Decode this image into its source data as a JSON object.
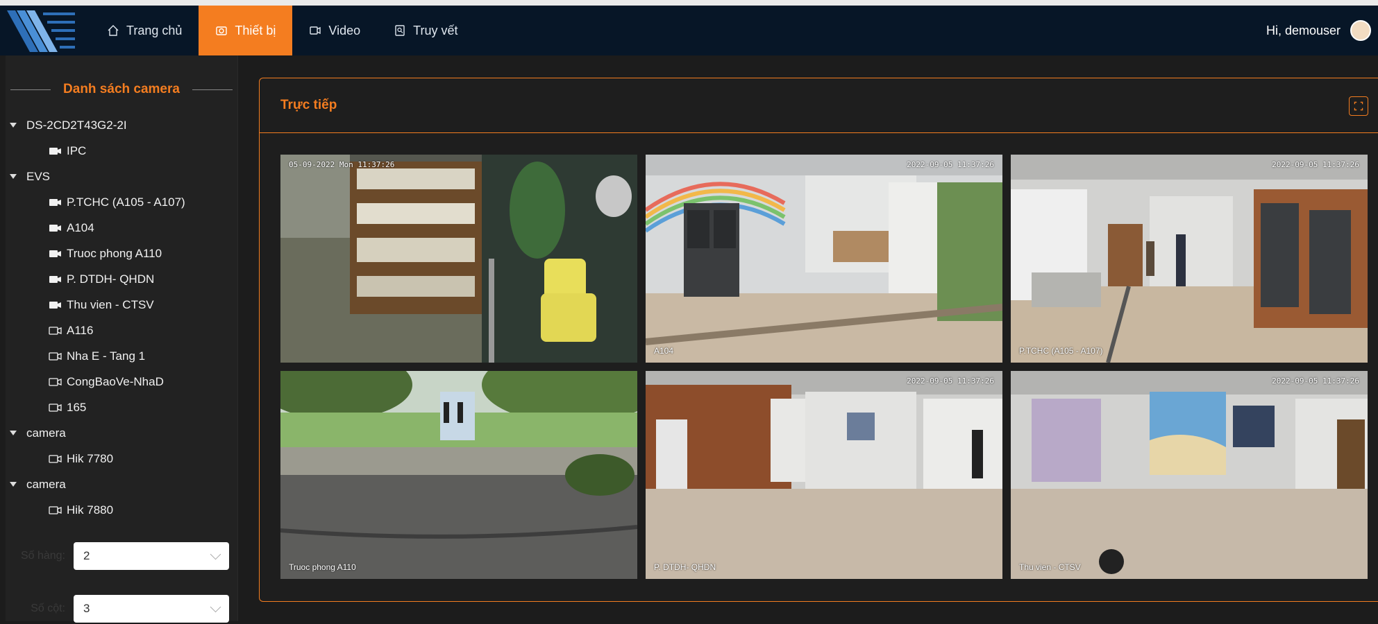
{
  "user": {
    "greeting": "Hi, demouser"
  },
  "nav": [
    {
      "label": "Trang chủ",
      "icon": "home-icon"
    },
    {
      "label": "Thiết bị",
      "icon": "camera-icon",
      "active": true
    },
    {
      "label": "Video",
      "icon": "video-icon"
    },
    {
      "label": "Truy vết",
      "icon": "trace-icon"
    }
  ],
  "sidebar": {
    "title": "Danh sách camera",
    "tree": [
      {
        "type": "group",
        "label": "DS-2CD2T43G2-2I"
      },
      {
        "type": "camera",
        "label": "IPC",
        "online": true
      },
      {
        "type": "group",
        "label": "EVS"
      },
      {
        "type": "camera",
        "label": "P.TCHC (A105 - A107)",
        "online": true
      },
      {
        "type": "camera",
        "label": "A104",
        "online": true
      },
      {
        "type": "camera",
        "label": "Truoc phong A110",
        "online": true
      },
      {
        "type": "camera",
        "label": "P. DTDH- QHDN",
        "online": true
      },
      {
        "type": "camera",
        "label": "Thu vien - CTSV",
        "online": true
      },
      {
        "type": "camera",
        "label": "A116",
        "online": false
      },
      {
        "type": "camera",
        "label": "Nha E - Tang 1",
        "online": false
      },
      {
        "type": "camera",
        "label": "CongBaoVe-NhaD",
        "online": false
      },
      {
        "type": "camera",
        "label": "165",
        "online": false
      },
      {
        "type": "group",
        "label": "camera"
      },
      {
        "type": "camera",
        "label": "Hik 7780",
        "online": false
      },
      {
        "type": "group",
        "label": "camera"
      },
      {
        "type": "camera",
        "label": "Hik 7880",
        "online": false
      }
    ],
    "rows_label": "Số hàng:",
    "rows_value": "2",
    "cols_label": "Số cột:",
    "cols_value": "3"
  },
  "panel": {
    "title": "Trực tiếp",
    "tiles": [
      {
        "label": "",
        "timestamp": "05-09-2022 Mon 11:37:26",
        "scene": "shop"
      },
      {
        "label": "A104",
        "timestamp": "2022-09-05 11:37:26",
        "scene": "rainbow"
      },
      {
        "label": "P.TCHC (A105 - A107)",
        "timestamp": "2022-09-05 11:37:26",
        "scene": "hall"
      },
      {
        "label": "Truoc phong A110",
        "timestamp": "",
        "scene": "outdoor"
      },
      {
        "label": "P. DTDH- QHDN",
        "timestamp": "2022-09-05 11:37:26",
        "scene": "corridor"
      },
      {
        "label": "Thu vien - CTSV",
        "timestamp": "2022-09-05 11:37:26",
        "scene": "mural"
      }
    ]
  },
  "colors": {
    "accent": "#f47d20",
    "topbar": "#071627",
    "sidebar": "#222222"
  }
}
